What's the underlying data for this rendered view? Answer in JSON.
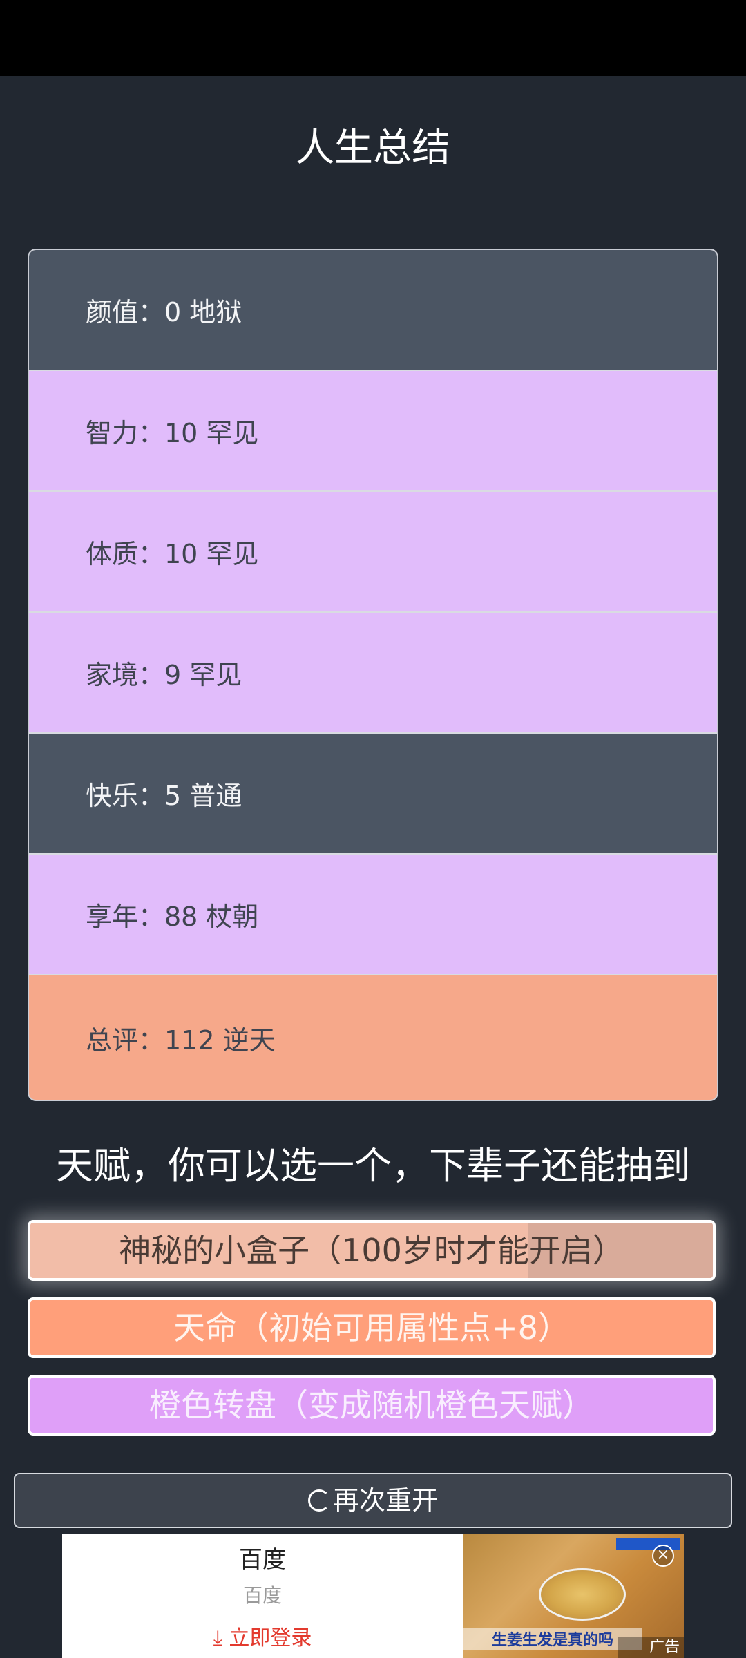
{
  "page": {
    "title": "人生总结"
  },
  "stats": [
    {
      "label": "颜值：0 地狱",
      "tier": "grey"
    },
    {
      "label": "智力：10 罕见",
      "tier": "purple"
    },
    {
      "label": "体质：10 罕见",
      "tier": "purple"
    },
    {
      "label": "家境：9 罕见",
      "tier": "purple"
    },
    {
      "label": "快乐：5 普通",
      "tier": "grey"
    },
    {
      "label": "享年：88 杖朝",
      "tier": "purple"
    },
    {
      "label": "总评：112 逆天",
      "tier": "orange"
    }
  ],
  "talents": {
    "heading": "天赋，你可以选一个，下辈子还能抽到",
    "items": [
      {
        "label": "神秘的小盒子（100岁时才能开启）",
        "progress": 0.73
      },
      {
        "label": "天命（初始可用属性点+8）"
      },
      {
        "label": "橙色转盘（变成随机橙色天赋）"
      }
    ]
  },
  "restart": {
    "label": "再次重开"
  },
  "ad": {
    "title": "百度",
    "subtitle": "百度",
    "link": "立即登录",
    "image_caption": "生姜生发是真的吗",
    "tag": "广告"
  },
  "colors": {
    "background": "#222831",
    "grey_tier": "#4b5563",
    "purple_tier": "#e1bcfb",
    "orange_tier": "#f6a88a",
    "fate_button": "#ff9f7a",
    "wheel_button": "#df9ff8"
  },
  "icons": {
    "restart": "refresh-icon",
    "download": "download-arrow-icon",
    "close": "close-icon"
  }
}
